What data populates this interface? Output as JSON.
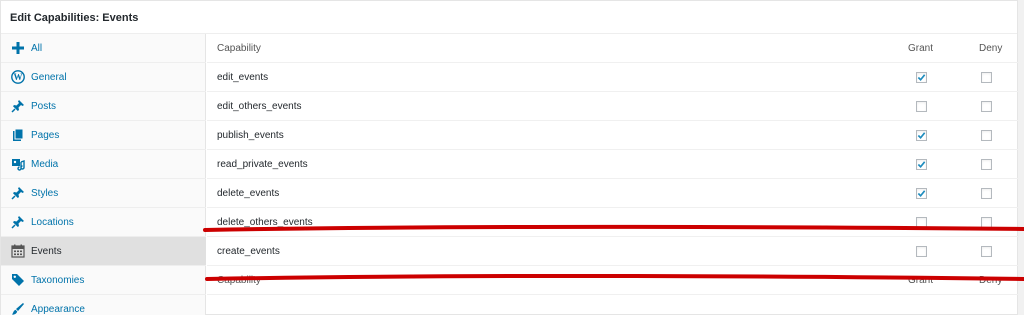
{
  "panel": {
    "title": "Edit Capabilities: Events"
  },
  "sidebar": {
    "items": [
      {
        "label": "All",
        "icon": "plus-icon",
        "active": false
      },
      {
        "label": "General",
        "icon": "wordpress-icon",
        "active": false
      },
      {
        "label": "Posts",
        "icon": "pushpin-icon",
        "active": false
      },
      {
        "label": "Pages",
        "icon": "pages-icon",
        "active": false
      },
      {
        "label": "Media",
        "icon": "media-icon",
        "active": false
      },
      {
        "label": "Styles",
        "icon": "pushpin-icon",
        "active": false
      },
      {
        "label": "Locations",
        "icon": "pushpin-icon",
        "active": false
      },
      {
        "label": "Events",
        "icon": "calendar-icon",
        "active": true
      },
      {
        "label": "Taxonomies",
        "icon": "tag-icon",
        "active": false
      },
      {
        "label": "Appearance",
        "icon": "brush-icon",
        "active": false
      }
    ]
  },
  "table": {
    "header": {
      "capability": "Capability",
      "grant": "Grant",
      "deny": "Deny"
    },
    "footer": {
      "capability": "Capability",
      "grant": "Grant",
      "deny": "Deny"
    },
    "rows": [
      {
        "capability": "edit_events",
        "grant": true,
        "deny": false
      },
      {
        "capability": "edit_others_events",
        "grant": false,
        "deny": false
      },
      {
        "capability": "publish_events",
        "grant": true,
        "deny": false
      },
      {
        "capability": "read_private_events",
        "grant": true,
        "deny": false
      },
      {
        "capability": "delete_events",
        "grant": true,
        "deny": false
      },
      {
        "capability": "delete_others_events",
        "grant": false,
        "deny": false
      },
      {
        "capability": "create_events",
        "grant": false,
        "deny": false
      }
    ]
  },
  "colors": {
    "link": "#0073aa",
    "annotation": "#cc0000",
    "check": "#1e8cbe"
  }
}
